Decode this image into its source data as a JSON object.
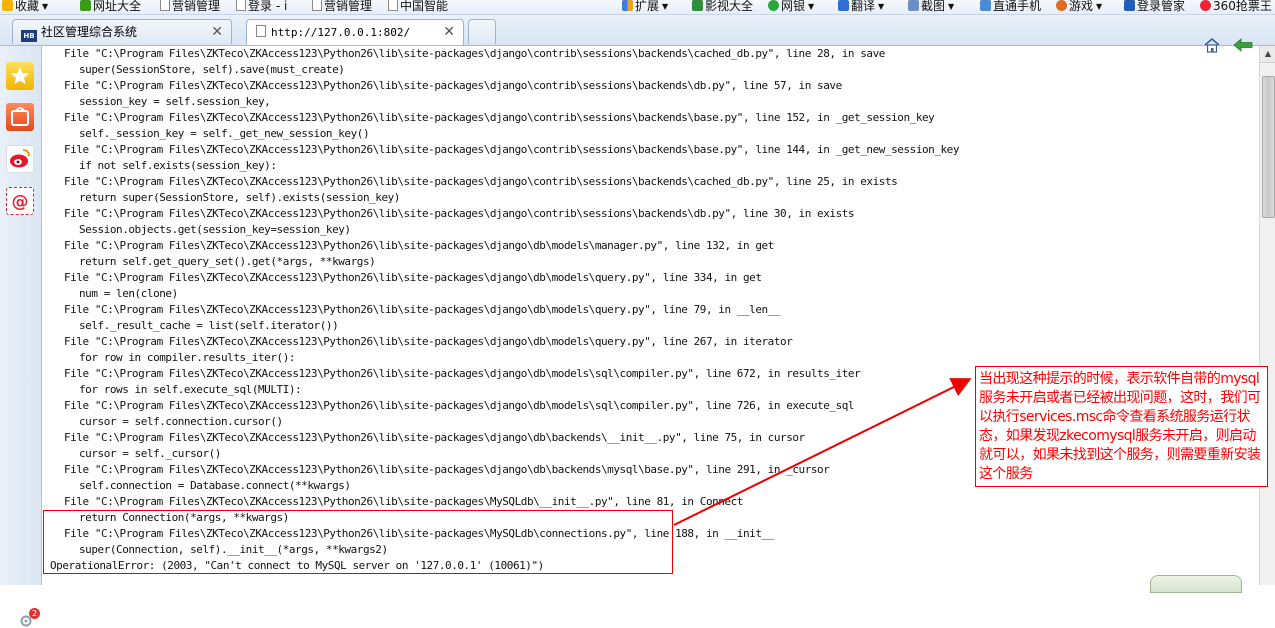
{
  "favorites_bar": {
    "items": [
      {
        "label": "收藏",
        "icon": "star-icon",
        "has_caret": true
      },
      {
        "label": "网址大全",
        "icon": "plus-icon",
        "has_caret": false
      },
      {
        "label": "营销管理",
        "icon": "page-icon",
        "has_caret": false
      },
      {
        "label": "登录 - i",
        "icon": "page-icon",
        "has_caret": false
      },
      {
        "label": "营销管理",
        "icon": "page-icon",
        "has_caret": false
      },
      {
        "label": "中国智能",
        "icon": "page-icon",
        "has_caret": false
      }
    ],
    "right_items": [
      {
        "label": "扩展",
        "icon": "grid-icon",
        "has_caret": true
      },
      {
        "label": "影视大全",
        "icon": "play-icon",
        "has_caret": false
      },
      {
        "label": "网银",
        "icon": "shield-icon",
        "has_caret": true
      },
      {
        "label": "翻译",
        "icon": "translate-icon",
        "has_caret": true
      },
      {
        "label": "截图",
        "icon": "screenshot-icon",
        "has_caret": true
      },
      {
        "label": "直通手机",
        "icon": "phone-icon",
        "has_caret": false
      },
      {
        "label": "游戏",
        "icon": "game-icon",
        "has_caret": true
      },
      {
        "label": "登录管家",
        "icon": "key-icon",
        "has_caret": false
      },
      {
        "label": "360抢票王",
        "icon": "360-icon",
        "has_caret": false
      }
    ]
  },
  "tabs": [
    {
      "label": "社区管理综合系统",
      "icon_text": "HB",
      "active": false
    },
    {
      "label": "http://127.0.0.1:802/",
      "active": true
    }
  ],
  "traceback": {
    "lines": [
      {
        "type": "file",
        "text": "File \"C:\\Program Files\\ZKTeco\\ZKAccess123\\Python26\\lib\\site-packages\\django\\contrib\\sessions\\backends\\cached_db.py\", line 28, in save"
      },
      {
        "type": "code",
        "text": "super(SessionStore, self).save(must_create)"
      },
      {
        "type": "file",
        "text": "File \"C:\\Program Files\\ZKTeco\\ZKAccess123\\Python26\\lib\\site-packages\\django\\contrib\\sessions\\backends\\db.py\", line 57, in save"
      },
      {
        "type": "code",
        "text": "session_key = self.session_key,"
      },
      {
        "type": "file",
        "text": "File \"C:\\Program Files\\ZKTeco\\ZKAccess123\\Python26\\lib\\site-packages\\django\\contrib\\sessions\\backends\\base.py\", line 152, in _get_session_key"
      },
      {
        "type": "code",
        "text": "self._session_key = self._get_new_session_key()"
      },
      {
        "type": "file",
        "text": "File \"C:\\Program Files\\ZKTeco\\ZKAccess123\\Python26\\lib\\site-packages\\django\\contrib\\sessions\\backends\\base.py\", line 144, in _get_new_session_key"
      },
      {
        "type": "code",
        "text": "if not self.exists(session_key):"
      },
      {
        "type": "file",
        "text": "File \"C:\\Program Files\\ZKTeco\\ZKAccess123\\Python26\\lib\\site-packages\\django\\contrib\\sessions\\backends\\cached_db.py\", line 25, in exists"
      },
      {
        "type": "code",
        "text": "return super(SessionStore, self).exists(session_key)"
      },
      {
        "type": "file",
        "text": "File \"C:\\Program Files\\ZKTeco\\ZKAccess123\\Python26\\lib\\site-packages\\django\\contrib\\sessions\\backends\\db.py\", line 30, in exists"
      },
      {
        "type": "code",
        "text": "Session.objects.get(session_key=session_key)"
      },
      {
        "type": "file",
        "text": "File \"C:\\Program Files\\ZKTeco\\ZKAccess123\\Python26\\lib\\site-packages\\django\\db\\models\\manager.py\", line 132, in get"
      },
      {
        "type": "code",
        "text": "return self.get_query_set().get(*args, **kwargs)"
      },
      {
        "type": "file",
        "text": "File \"C:\\Program Files\\ZKTeco\\ZKAccess123\\Python26\\lib\\site-packages\\django\\db\\models\\query.py\", line 334, in get"
      },
      {
        "type": "code",
        "text": "num = len(clone)"
      },
      {
        "type": "file",
        "text": "File \"C:\\Program Files\\ZKTeco\\ZKAccess123\\Python26\\lib\\site-packages\\django\\db\\models\\query.py\", line 79, in __len__"
      },
      {
        "type": "code",
        "text": "self._result_cache = list(self.iterator())"
      },
      {
        "type": "file",
        "text": "File \"C:\\Program Files\\ZKTeco\\ZKAccess123\\Python26\\lib\\site-packages\\django\\db\\models\\query.py\", line 267, in iterator"
      },
      {
        "type": "code",
        "text": "for row in compiler.results_iter():"
      },
      {
        "type": "file",
        "text": "File \"C:\\Program Files\\ZKTeco\\ZKAccess123\\Python26\\lib\\site-packages\\django\\db\\models\\sql\\compiler.py\", line 672, in results_iter"
      },
      {
        "type": "code",
        "text": "for rows in self.execute_sql(MULTI):"
      },
      {
        "type": "file",
        "text": "File \"C:\\Program Files\\ZKTeco\\ZKAccess123\\Python26\\lib\\site-packages\\django\\db\\models\\sql\\compiler.py\", line 726, in execute_sql"
      },
      {
        "type": "code",
        "text": "cursor = self.connection.cursor()"
      },
      {
        "type": "file",
        "text": "File \"C:\\Program Files\\ZKTeco\\ZKAccess123\\Python26\\lib\\site-packages\\django\\db\\backends\\__init__.py\", line 75, in cursor"
      },
      {
        "type": "code",
        "text": "cursor = self._cursor()"
      },
      {
        "type": "file",
        "text": "File \"C:\\Program Files\\ZKTeco\\ZKAccess123\\Python26\\lib\\site-packages\\django\\db\\backends\\mysql\\base.py\", line 291, in _cursor"
      },
      {
        "type": "code",
        "text": "self.connection = Database.connect(**kwargs)"
      },
      {
        "type": "file",
        "text": "File \"C:\\Program Files\\ZKTeco\\ZKAccess123\\Python26\\lib\\site-packages\\MySQLdb\\__init__.py\", line 81, in Connect"
      },
      {
        "type": "code",
        "text": "return Connection(*args, **kwargs)"
      },
      {
        "type": "file",
        "text": "File \"C:\\Program Files\\ZKTeco\\ZKAccess123\\Python26\\lib\\site-packages\\MySQLdb\\connections.py\", line 188, in __init__"
      },
      {
        "type": "code",
        "text": "super(Connection, self).__init__(*args, **kwargs2)"
      },
      {
        "type": "err",
        "text": "OperationalError: (2003, \"Can't connect to MySQL server on '127.0.0.1' (10061)\")"
      }
    ]
  },
  "annotation": {
    "text": "当出现这种提示的时候，表示软件自带的mysql服务未开启或者已经被出现问题，这时，我们可以执行services.msc命令查看系统服务运行状态，如果发现zkecomysql服务未开启，则启动就可以，如果未找到这个服务，则需要重新安装这个服务",
    "color": "#ff0000"
  },
  "sidebar": {
    "badge_count": "2"
  }
}
